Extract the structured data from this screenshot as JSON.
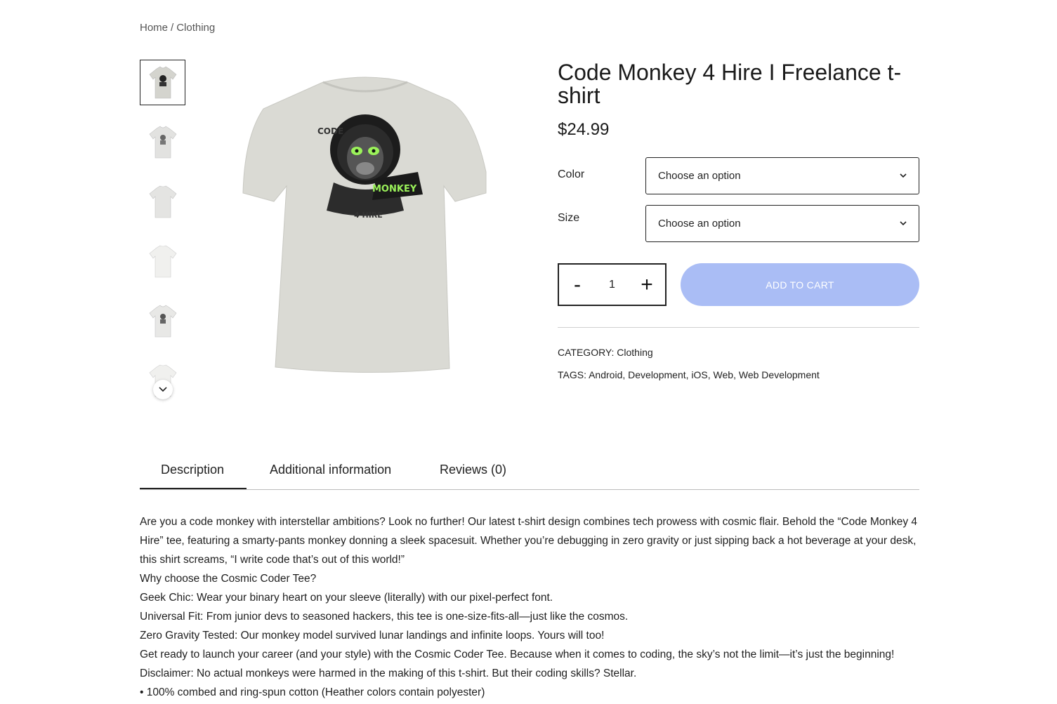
{
  "breadcrumb": {
    "home": "Home",
    "separator": "/",
    "current": "Clothing"
  },
  "gallery": {
    "thumbnails": [
      "thumb-front-design",
      "thumb-front-design-2",
      "thumb-back-plain",
      "thumb-back-plain-2",
      "thumb-front-design-3",
      "thumb-back-plain-3"
    ],
    "scroll_icon": "chevron-down-icon",
    "main_image": "tshirt-code-monkey"
  },
  "design_text": {
    "code": "CODE",
    "monkey": "MONKEY",
    "hire": "4 HIRE"
  },
  "product": {
    "title": "Code Monkey 4 Hire I Freelance t-shirt",
    "price": "$24.99",
    "color_label": "Color",
    "color_value": "Choose an option",
    "size_label": "Size",
    "size_value": "Choose an option",
    "qty_minus": "-",
    "qty_value": "1",
    "qty_plus": "+",
    "add_to_cart": "ADD TO CART",
    "category_label": "CATEGORY:",
    "category_value": "Clothing",
    "tags_label": "TAGS:",
    "tags": [
      "Android",
      "Development",
      "iOS",
      "Web",
      "Web Development"
    ]
  },
  "tabs": [
    {
      "label": "Description"
    },
    {
      "label": "Additional information"
    },
    {
      "label": "Reviews (0)"
    }
  ],
  "description": [
    "Are you a code monkey with interstellar ambitions? Look no further! Our latest t-shirt design combines tech prowess with cosmic flair. Behold the “Code Monkey 4 Hire” tee, featuring a smarty-pants monkey donning a sleek spacesuit. Whether you’re debugging in zero gravity or just sipping back a hot beverage at your desk, this shirt screams, “I write code that’s out of this world!”",
    "Why choose the Cosmic Coder Tee?",
    "Geek Chic: Wear your binary heart on your sleeve (literally) with our pixel-perfect font.",
    "Universal Fit: From junior devs to seasoned hackers, this tee is one-size-fits-all—just like the cosmos.",
    "Zero Gravity Tested: Our monkey model survived lunar landings and infinite loops. Yours will too!",
    "Get ready to launch your career (and your style) with the Cosmic Coder Tee. Because when it comes to coding, the sky’s not the limit—it’s just the beginning!",
    "Disclaimer: No actual monkeys were harmed in the making of this t-shirt. But their coding skills? Stellar.",
    "• 100% combed and ring-spun cotton (Heather colors contain polyester)"
  ],
  "colors": {
    "shirt": "#d8d8d2",
    "accent": "#aabdf5",
    "neon": "#9bf25a"
  }
}
